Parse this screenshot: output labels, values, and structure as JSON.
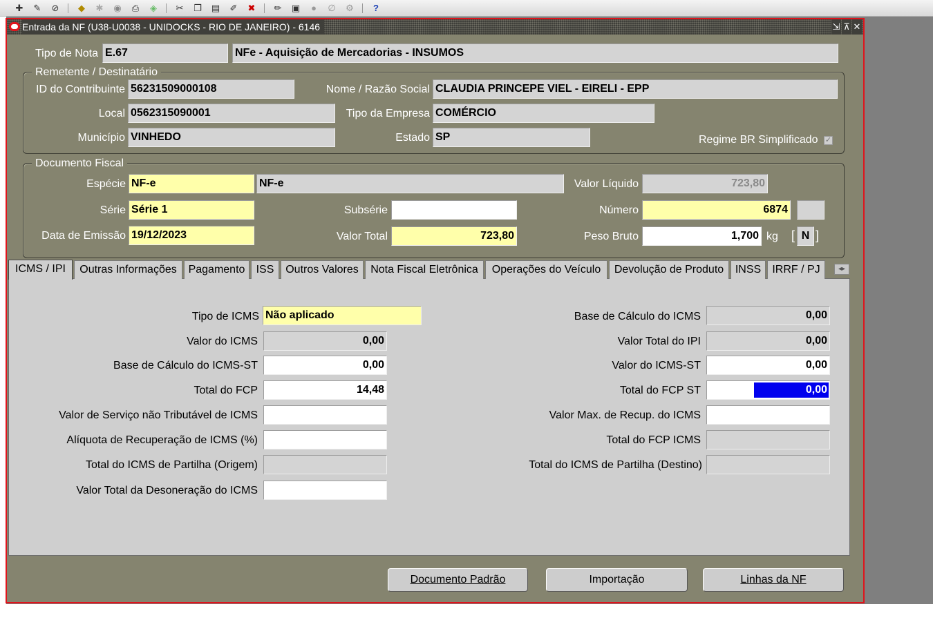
{
  "toolbar": {
    "icons": [
      "new-icon",
      "find-icon",
      "navigator-icon",
      "save-icon",
      "next-step-icon",
      "switch-resp-icon",
      "print-icon",
      "close-form-icon",
      "cut-icon",
      "copy-icon",
      "paste-icon",
      "clear-record-icon",
      "delete-record-icon",
      "edit-field-icon",
      "zoom-icon",
      "translations-icon",
      "attachments-icon",
      "folder-tools-icon",
      "help-icon"
    ],
    "help_label": "?"
  },
  "window": {
    "title": "Entrada da NF (U38-U0038 - UNIDOCKS - RIO DE JANEIRO) - 6146",
    "controls": [
      "⇲",
      "⊼",
      "✕"
    ]
  },
  "header": {
    "tipo_nota_label": "Tipo de Nota",
    "tipo_nota_code": "E.67",
    "tipo_nota_desc": "NFe - Aquisição de Mercadorias - INSUMOS"
  },
  "remetente": {
    "title": "Remetente / Destinatário",
    "id_label": "ID do Contribuinte",
    "id_value": "56231509000108",
    "nome_label": "Nome / Razão Social",
    "nome_value": "CLAUDIA PRINCEPE VIEL - EIRELI - EPP",
    "local_label": "Local",
    "local_value": "0562315090001",
    "tipo_empresa_label": "Tipo da Empresa",
    "tipo_empresa_value": "COMÉRCIO",
    "municipio_label": "Município",
    "municipio_value": "VINHEDO",
    "estado_label": "Estado",
    "estado_value": "SP",
    "regime_label": "Regime BR Simplificado",
    "regime_checked": true
  },
  "documento": {
    "title": "Documento Fiscal",
    "especie_label": "Espécie",
    "especie_code": "NF-e",
    "especie_desc": "NF-e",
    "valor_liquido_label": "Valor Líquido",
    "valor_liquido_value": "723,80",
    "serie_label": "Série",
    "serie_value": "Série 1",
    "subserie_label": "Subsérie",
    "subserie_value": "",
    "numero_label": "Número",
    "numero_value": "6874",
    "numero_extra": "",
    "data_label": "Data de Emissão",
    "data_value": "19/12/2023",
    "valor_total_label": "Valor Total",
    "valor_total_value": "723,80",
    "peso_label": "Peso Bruto",
    "peso_value": "1,700",
    "peso_unit": "kg",
    "flag_open": "[",
    "flag_value": "N",
    "flag_close": "]"
  },
  "tabs": [
    {
      "label": "ICMS / IPI",
      "active": true
    },
    {
      "label": "Outras Informações",
      "active": false
    },
    {
      "label": "Pagamento",
      "active": false
    },
    {
      "label": "ISS",
      "active": false
    },
    {
      "label": "Outros Valores",
      "active": false
    },
    {
      "label": "Nota Fiscal Eletrônica",
      "active": false
    },
    {
      "label": "Operações do Veículo",
      "active": false
    },
    {
      "label": "Devolução de Produto",
      "active": false
    },
    {
      "label": "INSS",
      "active": false
    },
    {
      "label": "IRRF / PJ",
      "active": false
    }
  ],
  "icms": {
    "tipo_icms_label": "Tipo de ICMS",
    "tipo_icms_value": "Não aplicado",
    "valor_icms_label": "Valor do ICMS",
    "valor_icms_value": "0,00",
    "base_st_label": "Base de Cálculo do ICMS-ST",
    "base_st_value": "0,00",
    "total_fcp_label": "Total do FCP",
    "total_fcp_value": "14,48",
    "servico_label": "Valor de Serviço não Tributável de ICMS",
    "servico_value": "",
    "aliquota_label": "Alíquota de Recuperação de ICMS (%)",
    "aliquota_value": "",
    "partilha_origem_label": "Total do ICMS de Partilha (Origem)",
    "partilha_origem_value": "",
    "desoneracao_label": "Valor Total da Desoneração do ICMS",
    "desoneracao_value": "",
    "base_icms_label": "Base de Cálculo do ICMS",
    "base_icms_value": "0,00",
    "valor_ipi_label": "Valor Total do IPI",
    "valor_ipi_value": "0,00",
    "valor_icms_st_label": "Valor do ICMS-ST",
    "valor_icms_st_value": "0,00",
    "fcp_st_label": "Total do FCP ST",
    "fcp_st_value": "0,00",
    "max_recup_label": "Valor Max. de Recup. do ICMS",
    "max_recup_value": "",
    "fcp_icms_label": "Total do FCP ICMS",
    "fcp_icms_value": "",
    "partilha_destino_label": "Total do ICMS de Partilha (Destino)",
    "partilha_destino_value": ""
  },
  "buttons": {
    "documento_padrao": "Documento Padrão",
    "importacao": "Importação",
    "linhas_nf": "Linhas da NF"
  }
}
